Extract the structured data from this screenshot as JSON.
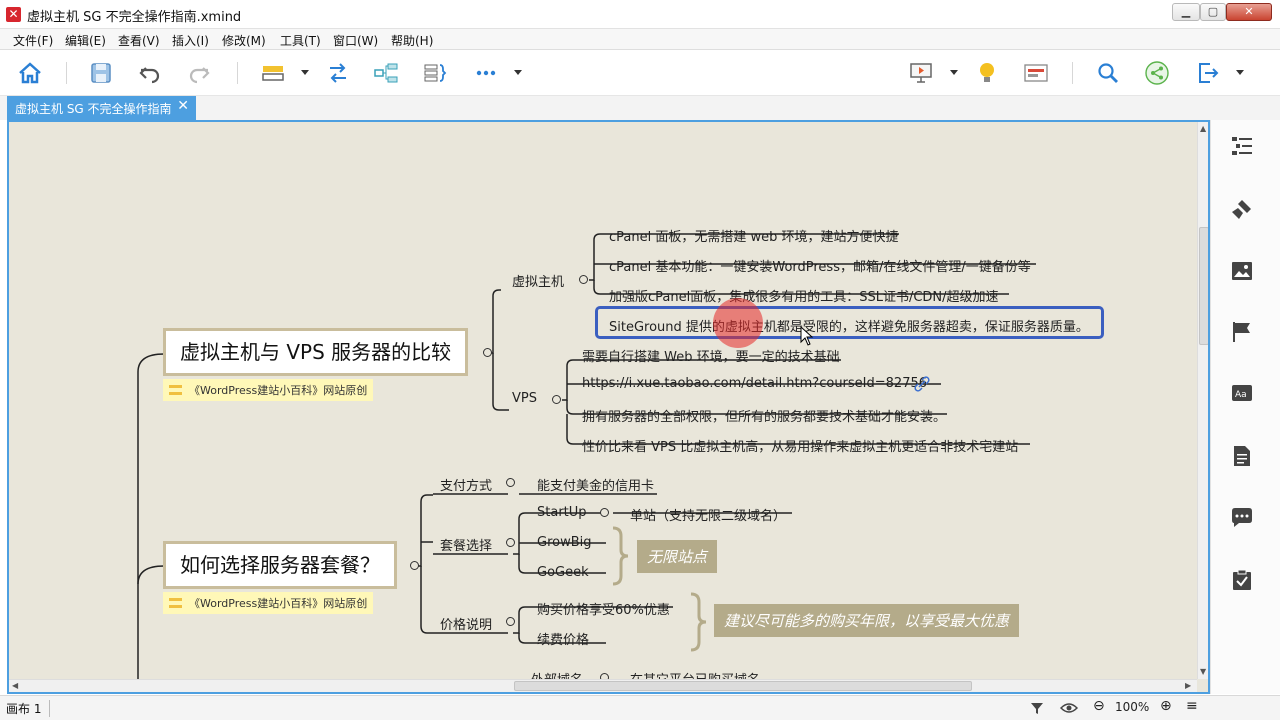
{
  "window": {
    "title": "虚拟主机 SG 不完全操作指南.xmind",
    "minimize": "▁",
    "maximize": "▢",
    "close": "✕"
  },
  "menu": [
    "文件(F)",
    "编辑(E)",
    "查看(V)",
    "插入(I)",
    "修改(M)",
    "工具(T)",
    "窗口(W)",
    "帮助(H)"
  ],
  "toolbar": {
    "icons": [
      "home-icon",
      "save-icon",
      "undo-icon",
      "redo-icon",
      "topic-icon",
      "relationship-icon",
      "structure-icon",
      "summary-icon",
      "more-icon",
      "presentation-icon",
      "idea-icon",
      "gantt-icon",
      "search-icon",
      "share-icon",
      "export-icon"
    ]
  },
  "tab": {
    "label": "虚拟主机 SG 不完全操作指南",
    "close": "✕"
  },
  "mindmap": {
    "topic1": {
      "title": "虚拟主机与 VPS 服务器的比较",
      "label": "《WordPress建站小百科》网站原创",
      "branches": {
        "virtual_host": {
          "label": "虚拟主机",
          "items": [
            "cPanel 面板，无需搭建 web 环境，建站方便快捷",
            "cPanel 基本功能：一键安装WordPress，邮箱/在线文件管理/一键备份等",
            "加强版cPanel面板，集成很多有用的工具：SSL证书/CDN/超级加速",
            "SiteGround 提供的虚拟主机都是受限的，这样避免服务器超卖，保证服务器质量。"
          ]
        },
        "vps": {
          "label": "VPS",
          "items": [
            "需要自行搭建 Web 环境，要一定的技术基础",
            "https://i.xue.taobao.com/detail.htm?courseId=82756",
            "拥有服务器的全部权限，但所有的服务都要技术基础才能安装。",
            "性价比来看 VPS 比虚拟主机高，从易用操作来虚拟主机更适合非技术宅建站"
          ]
        }
      }
    },
    "topic2": {
      "title": "如何选择服务器套餐？",
      "label": "《WordPress建站小百科》网站原创",
      "branches": {
        "payment": {
          "label": "支付方式",
          "item": "能支付美金的信用卡"
        },
        "plans": {
          "label": "套餐选择",
          "items": [
            "StartUp",
            "GrowBig",
            "GoGeek"
          ],
          "startup_note": "单站（支持无限二级域名）",
          "summary": "无限站点"
        },
        "price": {
          "label": "价格说明",
          "items": [
            "购买价格享受60%优惠",
            "续费价格"
          ],
          "summary": "建议尽可能多的购买年限，以享受最大优惠"
        }
      }
    },
    "partial": {
      "left": "外部域名",
      "right": "在其它平台已购买域名"
    }
  },
  "right_panel": {
    "icons": [
      "outline-icon",
      "format-brush-icon",
      "image-icon",
      "flag-marker-icon",
      "text-style-icon",
      "notes-icon",
      "comment-icon",
      "task-icon"
    ]
  },
  "status": {
    "sheet": "画布 1",
    "zoom": "100%",
    "zoom_out": "⊖",
    "zoom_in": "⊕",
    "menu": "≡"
  },
  "colors": {
    "accent": "#4d9fe0",
    "canvas": "#e9e6da",
    "topic_border": "#c9bd9c",
    "selection": "#3b5fc0",
    "summary_bg": "#b4ab8a",
    "label_bg": "#fff8b8"
  }
}
